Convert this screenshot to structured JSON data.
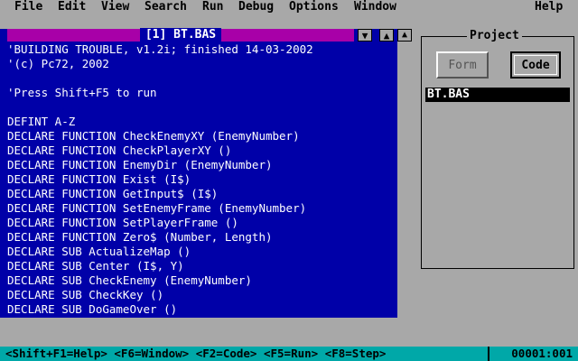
{
  "menu": {
    "items": [
      "File",
      "Edit",
      "View",
      "Search",
      "Run",
      "Debug",
      "Options",
      "Window"
    ],
    "help": "Help"
  },
  "editor": {
    "title": "[1] BT.BAS",
    "scroll_down_glyph": "▼",
    "scroll_up_glyph": "▲",
    "lines": [
      "'BUILDING TROUBLE, v1.2i; finished 14-03-2002",
      "'(c) Pc72, 2002",
      "",
      "'Press Shift+F5 to run",
      "",
      "DEFINT A-Z",
      "DECLARE FUNCTION CheckEnemyXY (EnemyNumber)",
      "DECLARE FUNCTION CheckPlayerXY ()",
      "DECLARE FUNCTION EnemyDir (EnemyNumber)",
      "DECLARE FUNCTION Exist (I$)",
      "DECLARE FUNCTION GetInput$ (I$)",
      "DECLARE FUNCTION SetEnemyFrame (EnemyNumber)",
      "DECLARE FUNCTION SetPlayerFrame ()",
      "DECLARE FUNCTION Zero$ (Number, Length)",
      "DECLARE SUB ActualizeMap ()",
      "DECLARE SUB Center (I$, Y)",
      "DECLARE SUB CheckEnemy (EnemyNumber)",
      "DECLARE SUB CheckKey ()",
      "DECLARE SUB DoGameOver ()"
    ]
  },
  "project": {
    "title": "Project",
    "form_button": "Form",
    "code_button": "Code",
    "files": [
      "BT.BAS"
    ]
  },
  "status": {
    "text": "<Shift+F1=Help> <F6=Window> <F2=Code> <F5=Run> <F8=Step>",
    "position": "00001:001"
  }
}
